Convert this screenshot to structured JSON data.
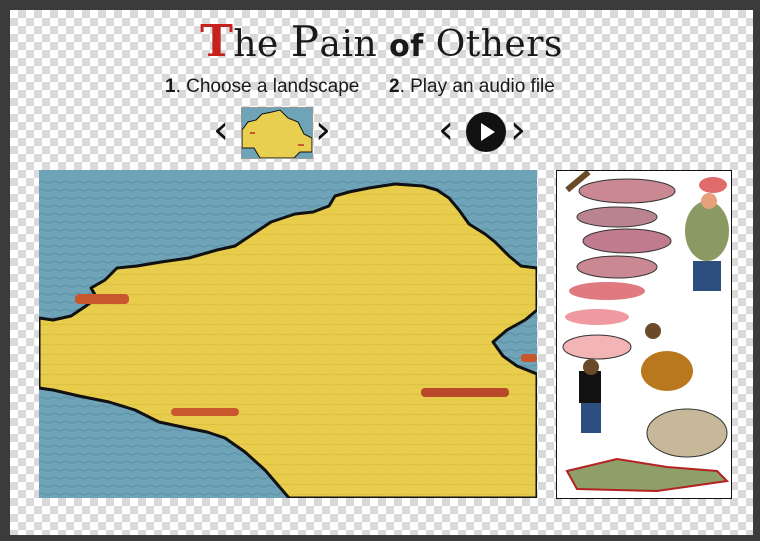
{
  "title": {
    "t_initial": "T",
    "t_rest": "he ",
    "p_initial": "P",
    "p_rest": "ain ",
    "of": "of",
    "others": " Others"
  },
  "steps": {
    "step1_number": "1",
    "step1_text": ". Choose a landscape",
    "step2_number": "2",
    "step2_text": ". Play an audio file"
  },
  "nav": {
    "prev_glyph": "‹",
    "next_glyph": "›"
  },
  "colors": {
    "title_accent": "#c5221c",
    "water": "#6fa3b8",
    "land": "#e9cf4f",
    "outline": "#111111"
  },
  "icons": {
    "landscape_prev": "chevron-left-icon",
    "landscape_next": "chevron-right-icon",
    "audio_prev": "chevron-left-icon",
    "audio_next": "chevron-right-icon",
    "audio_play": "play-icon"
  }
}
